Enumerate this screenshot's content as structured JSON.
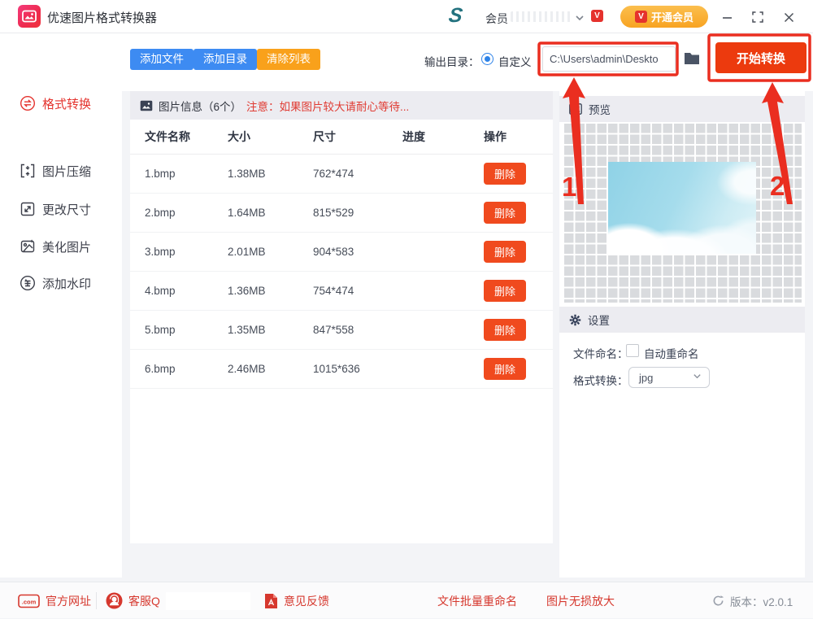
{
  "window": {
    "title": "优速图片格式转换器",
    "logo_letter": "S",
    "member_label": "会员",
    "vip_badge": "V",
    "vip_button_label": "开通会员"
  },
  "sidebar": {
    "items": [
      {
        "label": "格式转换",
        "active": true
      },
      {
        "label": "图片压缩",
        "active": false
      },
      {
        "label": "更改尺寸",
        "active": false
      },
      {
        "label": "美化图片",
        "active": false
      },
      {
        "label": "添加水印",
        "active": false
      }
    ]
  },
  "toolbar": {
    "add_files": "添加文件",
    "add_folder": "添加目录",
    "clear_list": "清除列表",
    "output_dir_label": "输出目录：",
    "custom_label": "自定义",
    "path_value": "C:\\Users\\admin\\Deskto",
    "start_button": "开始转换"
  },
  "table": {
    "info_title": "图片信息（6个）",
    "info_warning": "注意：如果图片较大请耐心等待...",
    "columns": [
      "文件名称",
      "大小",
      "尺寸",
      "进度",
      "操作"
    ],
    "delete_label": "删除",
    "rows": [
      {
        "name": "1.bmp",
        "size": "1.38MB",
        "dims": "762*474"
      },
      {
        "name": "2.bmp",
        "size": "1.64MB",
        "dims": "815*529"
      },
      {
        "name": "3.bmp",
        "size": "2.01MB",
        "dims": "904*583"
      },
      {
        "name": "4.bmp",
        "size": "1.36MB",
        "dims": "754*474"
      },
      {
        "name": "5.bmp",
        "size": "1.35MB",
        "dims": "847*558"
      },
      {
        "name": "6.bmp",
        "size": "2.46MB",
        "dims": "1015*636"
      }
    ]
  },
  "preview": {
    "title": "预览"
  },
  "settings": {
    "title": "设置",
    "naming_label": "文件命名：",
    "rename_checkbox_label": "自动重命名",
    "format_label": "格式转换：",
    "format_value": "jpg"
  },
  "footer": {
    "com_icon_text": ".com",
    "website": "官方网址",
    "support": "客服Q",
    "feedback": "意见反馈",
    "batch_rename": "文件批量重命名",
    "lossless_zoom": "图片无损放大",
    "version": "版本：v2.0.1"
  },
  "annotations": {
    "label1": "1",
    "label2": "2"
  },
  "colors": {
    "accent_blue": "#3d8bf2",
    "accent_orange": "#f9a11b",
    "accent_red": "#ec3a0e",
    "delete_red": "#f04a1e",
    "annotation_red": "#ea2e20",
    "active_sidebar_red": "#e4332e",
    "footer_link_red": "#d6382e"
  }
}
